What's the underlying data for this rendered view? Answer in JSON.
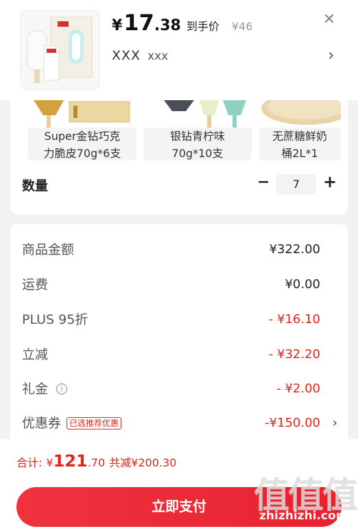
{
  "header": {
    "price_yen": "¥",
    "price_int": "17",
    "price_dec": ".38",
    "price_tag": "到手价",
    "orig_price": "¥46",
    "sku_main": "XXX",
    "sku_sub": "xxx",
    "close_icon": "close-icon",
    "arrow_icon": "chevron-right-icon"
  },
  "variants": [
    {
      "name": "Super金钻巧克\n力脆皮70g*6支"
    },
    {
      "name": "银钻青柠味\n70g*10支"
    },
    {
      "name": "无蔗糖鲜奶\n桶2L*1"
    }
  ],
  "quantity": {
    "label": "数量",
    "minus": "−",
    "value": "7",
    "plus": "+"
  },
  "summary": {
    "goods_label": "商品金额",
    "goods_value": "¥322.00",
    "shipping_label": "运费",
    "shipping_value": "¥0.00",
    "plus_label": "PLUS 95折",
    "plus_value": "- ¥16.10",
    "discount_label": "立减",
    "discount_value": "- ¥32.20",
    "gift_label": "礼金",
    "gift_value": "- ¥2.00",
    "gift_info_icon": "i",
    "coupon_label": "优惠券",
    "coupon_tag": "已选推荐优惠",
    "coupon_value": "-¥150.00",
    "coupon_arrow": "›"
  },
  "footer": {
    "total_label": "合计:",
    "total_yen": "¥",
    "total_int": "121",
    "total_dec": ".70",
    "saved": "共减¥200.30",
    "pay_label": "立即支付"
  },
  "watermark": {
    "chars": "值值值",
    "url": "zhizhizhi.com"
  },
  "colors": {
    "accent": "#e1251b",
    "button": "#ee2b37"
  }
}
